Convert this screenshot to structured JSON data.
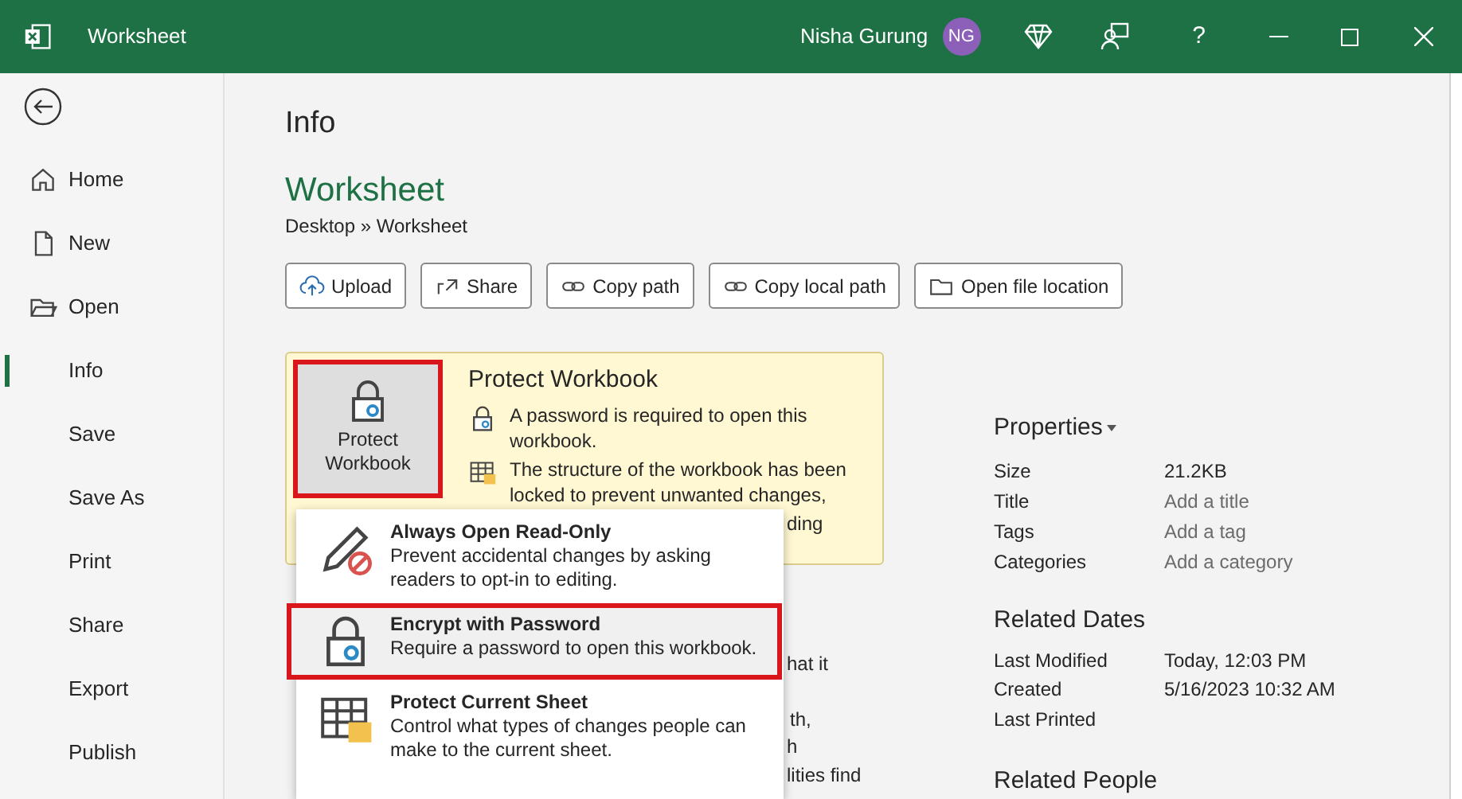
{
  "title_bar": {
    "title": "Worksheet",
    "user_name": "Nisha Gurung",
    "user_initials": "NG",
    "help": "?"
  },
  "sidebar": {
    "items": [
      {
        "label": "Home",
        "selected": false
      },
      {
        "label": "New",
        "selected": false
      },
      {
        "label": "Open",
        "selected": false
      },
      {
        "label": "Info",
        "selected": true
      },
      {
        "label": "Save",
        "selected": false
      },
      {
        "label": "Save As",
        "selected": false
      },
      {
        "label": "Print",
        "selected": false
      },
      {
        "label": "Share",
        "selected": false
      },
      {
        "label": "Export",
        "selected": false
      },
      {
        "label": "Publish",
        "selected": false
      }
    ]
  },
  "info": {
    "heading": "Info",
    "file_name": "Worksheet",
    "path": "Desktop » Worksheet",
    "actions": [
      {
        "label": "Upload"
      },
      {
        "label": "Share"
      },
      {
        "label": "Copy path"
      },
      {
        "label": "Copy local path"
      },
      {
        "label": "Open file location"
      }
    ]
  },
  "protect": {
    "button_label": "Protect Workbook",
    "highlighted": true,
    "title": "Protect Workbook",
    "notes": [
      {
        "text": "A password is required to open this workbook."
      },
      {
        "text": "The structure of the workbook has been locked to prevent unwanted changes,"
      }
    ]
  },
  "menu": {
    "items": [
      {
        "title": "Always Open Read-Only",
        "description": "Prevent accidental changes by asking readers to opt-in to editing.",
        "highlighted": false
      },
      {
        "title": "Encrypt with Password",
        "description": "Require a password to open this workbook.",
        "highlighted": true
      },
      {
        "title": "Protect Current Sheet",
        "description": "Control what types of changes people can make to the current sheet.",
        "highlighted": false
      }
    ]
  },
  "obscured_fragments": [
    {
      "text": "ding"
    },
    {
      "text": "hat it"
    },
    {
      "text": "th,"
    },
    {
      "text": "h"
    },
    {
      "text": "lities find"
    }
  ],
  "properties": {
    "heading": "Properties",
    "rows": [
      {
        "label": "Size",
        "value": "21.2KB"
      },
      {
        "label": "Title",
        "placeholder": "Add a title"
      },
      {
        "label": "Tags",
        "placeholder": "Add a tag"
      },
      {
        "label": "Categories",
        "placeholder": "Add a category"
      }
    ]
  },
  "related_dates": {
    "heading": "Related Dates",
    "rows": [
      {
        "label": "Last Modified",
        "value": "Today, 12:03 PM"
      },
      {
        "label": "Created",
        "value": "5/16/2023 10:32 AM"
      },
      {
        "label": "Last Printed"
      }
    ]
  },
  "related_people": {
    "heading": "Related People"
  }
}
